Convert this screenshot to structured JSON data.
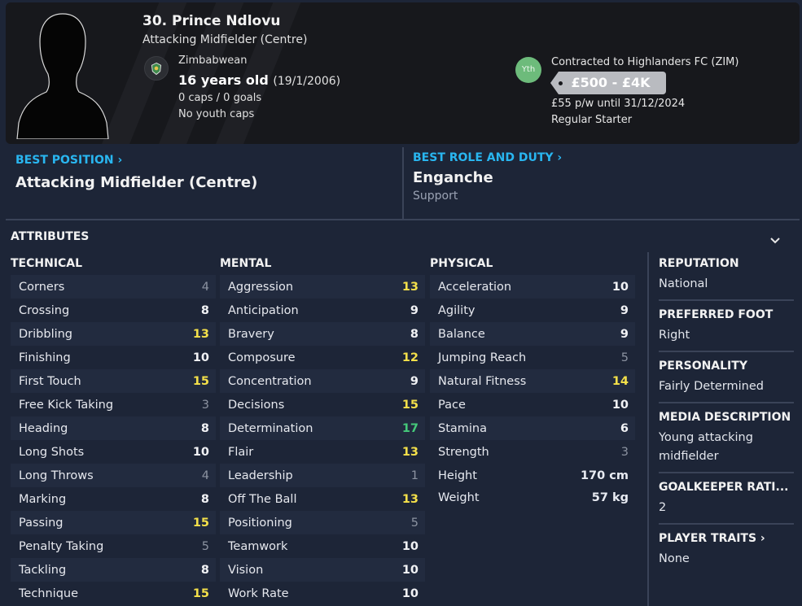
{
  "player": {
    "name": "30. Prince Ndlovu",
    "position": "Attacking Midfielder (Centre)",
    "nationality": "Zimbabwean",
    "age": "16 years old",
    "dob": "(19/1/2006)",
    "caps": "0 caps / 0 goals",
    "youth_caps": "No youth caps"
  },
  "contract": {
    "badge": "Yth",
    "club": "Contracted to Highlanders FC (ZIM)",
    "value": "£500 - £4K",
    "wage": "£55 p/w until 31/12/2024",
    "status": "Regular Starter"
  },
  "best_position": {
    "title": "BEST POSITION",
    "value": "Attacking Midfielder (Centre)"
  },
  "best_role": {
    "title": "BEST ROLE AND DUTY",
    "role": "Enganche",
    "duty": "Support"
  },
  "attributes": {
    "heading": "ATTRIBUTES",
    "technical": {
      "title": "TECHNICAL",
      "items": [
        {
          "label": "Corners",
          "value": "4"
        },
        {
          "label": "Crossing",
          "value": "8"
        },
        {
          "label": "Dribbling",
          "value": "13"
        },
        {
          "label": "Finishing",
          "value": "10"
        },
        {
          "label": "First Touch",
          "value": "15"
        },
        {
          "label": "Free Kick Taking",
          "value": "3"
        },
        {
          "label": "Heading",
          "value": "8"
        },
        {
          "label": "Long Shots",
          "value": "10"
        },
        {
          "label": "Long Throws",
          "value": "4"
        },
        {
          "label": "Marking",
          "value": "8"
        },
        {
          "label": "Passing",
          "value": "15"
        },
        {
          "label": "Penalty Taking",
          "value": "5"
        },
        {
          "label": "Tackling",
          "value": "8"
        },
        {
          "label": "Technique",
          "value": "15"
        }
      ]
    },
    "mental": {
      "title": "MENTAL",
      "items": [
        {
          "label": "Aggression",
          "value": "13"
        },
        {
          "label": "Anticipation",
          "value": "9"
        },
        {
          "label": "Bravery",
          "value": "8"
        },
        {
          "label": "Composure",
          "value": "12"
        },
        {
          "label": "Concentration",
          "value": "9"
        },
        {
          "label": "Decisions",
          "value": "15"
        },
        {
          "label": "Determination",
          "value": "17"
        },
        {
          "label": "Flair",
          "value": "13"
        },
        {
          "label": "Leadership",
          "value": "1"
        },
        {
          "label": "Off The Ball",
          "value": "13"
        },
        {
          "label": "Positioning",
          "value": "5"
        },
        {
          "label": "Teamwork",
          "value": "10"
        },
        {
          "label": "Vision",
          "value": "10"
        },
        {
          "label": "Work Rate",
          "value": "10"
        }
      ]
    },
    "physical": {
      "title": "PHYSICAL",
      "items": [
        {
          "label": "Acceleration",
          "value": "10"
        },
        {
          "label": "Agility",
          "value": "9"
        },
        {
          "label": "Balance",
          "value": "9"
        },
        {
          "label": "Jumping Reach",
          "value": "5"
        },
        {
          "label": "Natural Fitness",
          "value": "14"
        },
        {
          "label": "Pace",
          "value": "10"
        },
        {
          "label": "Stamina",
          "value": "6"
        },
        {
          "label": "Strength",
          "value": "3"
        }
      ],
      "height_label": "Height",
      "height": "170 cm",
      "weight_label": "Weight",
      "weight": "57 kg"
    }
  },
  "side": {
    "reputation_title": "REPUTATION",
    "reputation": "National",
    "foot_title": "PREFERRED FOOT",
    "foot": "Right",
    "personality_title": "PERSONALITY",
    "personality": "Fairly Determined",
    "media_title": "MEDIA DESCRIPTION",
    "media": "Young attacking midfielder",
    "gk_title": "GOALKEEPER RATI...",
    "gk": "2",
    "traits_title": "PLAYER TRAITS",
    "traits": "None"
  },
  "colors": {
    "accent": "#29b6f0",
    "attr_low": "#8c93a1",
    "attr_mid": "#f1f2f5",
    "attr_good": "#f4e04a",
    "attr_great": "#45c97a",
    "youth_badge": "#6dbb7b"
  }
}
